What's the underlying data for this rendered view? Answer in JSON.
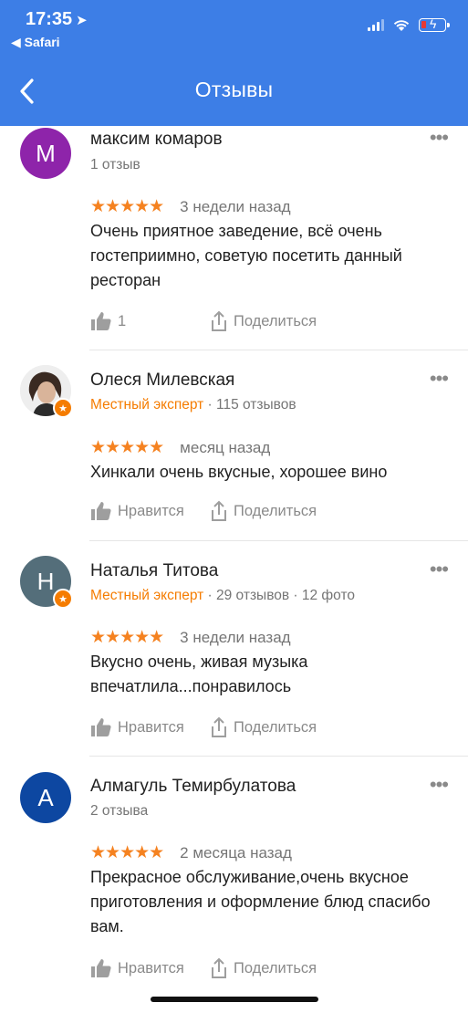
{
  "status": {
    "time": "17:35",
    "back_app": "◀ Safari"
  },
  "header": {
    "title": "Отзывы"
  },
  "colors": {
    "header_bg": "#3d7ee6",
    "stars": "#f58220",
    "expert": "#f57c00"
  },
  "reviews": [
    {
      "avatar_letter": "М",
      "avatar_color": "#8e24aa",
      "name": "максим комаров",
      "reviews_count": "1 отзыв",
      "stars": "★★★★★",
      "rating": 5,
      "date": "3 недели назад",
      "text": "Очень приятное заведение, всё очень гостеприимно, советую посетить данный ресторан",
      "like_label": "1",
      "share_label": "Поделиться"
    },
    {
      "avatar_letter": "",
      "name": "Олеся Милевская",
      "expert_label": "Местный эксперт",
      "reviews_count": "· 115 отзывов",
      "stars": "★★★★★",
      "rating": 5,
      "date": "месяц назад",
      "text": "Хинкали очень вкусные, хорошее вино",
      "like_label": "Нравится",
      "share_label": "Поделиться"
    },
    {
      "avatar_letter": "Н",
      "avatar_color": "#546e7a",
      "name": "Наталья Титова",
      "expert_label": "Местный эксперт",
      "reviews_count": "· 29 отзывов · 12 фото",
      "stars": "★★★★★",
      "rating": 5,
      "date": "3 недели назад",
      "text": "Вкусно очень, живая музыка впечатлила...понравилось",
      "like_label": "Нравится",
      "share_label": "Поделиться"
    },
    {
      "avatar_letter": "A",
      "avatar_color": "#0d47a1",
      "name": "Алмагуль Темирбулатова",
      "reviews_count": "2 отзыва",
      "stars": "★★★★★",
      "rating": 5,
      "date": "2 месяца назад",
      "text": "Прекрасное обслуживание,очень вкусное приготовления и оформление блюд спасибо вам.",
      "like_label": "Нравится",
      "share_label": "Поделиться"
    }
  ]
}
